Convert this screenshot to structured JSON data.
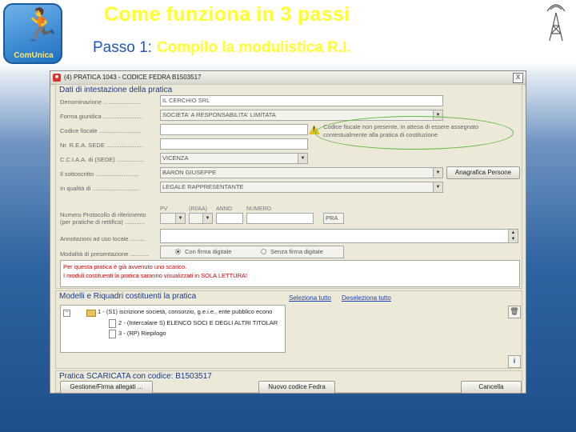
{
  "slide": {
    "logo_text": "ComUnica",
    "title": "Come funziona in 3 passi",
    "subtitle_step": "Passo 1:",
    "subtitle_rest": "Compilo la modulistica R.I."
  },
  "window": {
    "title": "(4) PRATICA 1043 - CODICE FEDRA B1503517",
    "close": "X"
  },
  "section1": {
    "title": "Dati di intestazione della pratica",
    "denominazione_label": "Denominazione .......................",
    "denominazione_value": "IL CERCHIO SRL",
    "forma_label": "Forma giuridica ........................",
    "forma_value": "SOCIETA' A RESPONSABILITA' LIMITATA",
    "codice_fiscale_label": "Codice fiscale .........................",
    "codice_fiscale_value": "",
    "rea_label": "Nr. R.E.A. SEDE ......................",
    "rea_value": "",
    "cciaa_label": "C.C.I.A.A. di (SEDE) ................",
    "cciaa_value": "VICENZA",
    "sottoscritto_label": "Il sottoscritto ..........................",
    "sottoscritto_value": "BARON GIUSEPPE",
    "anagrafica_button": "Anagrafica Persone",
    "qualita_label": "In qualità di ............................",
    "qualita_value": "LEGALE RAPPRESENTANTE",
    "protocollo_label_1": "Numero Protocollo di riferimento",
    "protocollo_label_2": "(per pratiche di rettifica) ............",
    "pv_label": "PV",
    "riaa_label": "(RI/AA)",
    "anno_label": "ANNO",
    "numero_label": "NUMERO",
    "pra_value": "PRA",
    "annotazioni_label": "Annotazioni ad uso locale .........",
    "modalita_label": "Modalità di presentazione ...........",
    "con_firma": "Con firma digitale",
    "senza_firma": "Senza firma digitale",
    "warning_text": "Codice fiscale non presente, in attesa di essere assegnato contestualmente alla pratica di costituzione",
    "notice_line1": "Per questa pratica è già avvenuto uno scarico.",
    "notice_line2": "I moduli costituenti la pratica saranno visualizzati in SOLA LETTURA!"
  },
  "section2": {
    "title": "Modelli e Riquadri costituenti la pratica",
    "select_all": "Seleziona tutto",
    "deselect_all": "Deseleziona tutto",
    "tree": [
      "1 - (S1) iscrizione società, consorzio, g.e.i.e., ente pubblico econo",
      "2 - (Intercalare S) ELENCO SOCI E DEGLI ALTRI TITOLAR",
      "3 - (RP) Riepilogo"
    ]
  },
  "section3": {
    "title": "Pratica SCARICATA con codice: B1503517",
    "gestione_button": "Gestione/Firma allegati ...",
    "nuovo_button": "Nuovo codice Fedra",
    "cancella_button": "Cancella"
  },
  "colors": {
    "title_yellow": "#ffff2e",
    "step_blue": "#2358b6",
    "group_title_blue": "#1a3b8f",
    "notice_red": "#cc0000",
    "highlight_green": "#5fba3f"
  },
  "icons": {
    "logo": "running-man-icon",
    "antenna": "radio-tower-icon",
    "warning": "warning-icon",
    "trash": "trash-icon",
    "info": "info-icon"
  }
}
